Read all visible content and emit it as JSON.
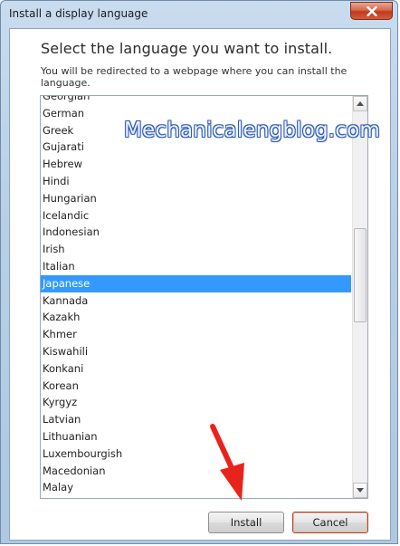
{
  "window": {
    "title": "Install a display language"
  },
  "dialog": {
    "heading": "Select the language you want to install.",
    "subtext": "You will be redirected to a webpage where you can install the language."
  },
  "languages": [
    "Georgian",
    "German",
    "Greek",
    "Gujarati",
    "Hebrew",
    "Hindi",
    "Hungarian",
    "Icelandic",
    "Indonesian",
    "Irish",
    "Italian",
    "Japanese",
    "Kannada",
    "Kazakh",
    "Khmer",
    "Kiswahili",
    "Konkani",
    "Korean",
    "Kyrgyz",
    "Latvian",
    "Lithuanian",
    "Luxembourgish",
    "Macedonian",
    "Malay"
  ],
  "selected_language": "Japanese",
  "watermark": "Mechanicalengblog.com",
  "buttons": {
    "install_label": "Install",
    "cancel_label": "Cancel"
  },
  "icons": {
    "close": "close-icon",
    "scroll_up": "chevron-up-icon",
    "scroll_down": "chevron-down-icon",
    "annotation": "red-arrow-icon"
  },
  "colors": {
    "selection": "#3399ff",
    "close_button": "#c2391c",
    "annotation_arrow": "#e8231c",
    "watermark_outline": "#2a59b8"
  }
}
